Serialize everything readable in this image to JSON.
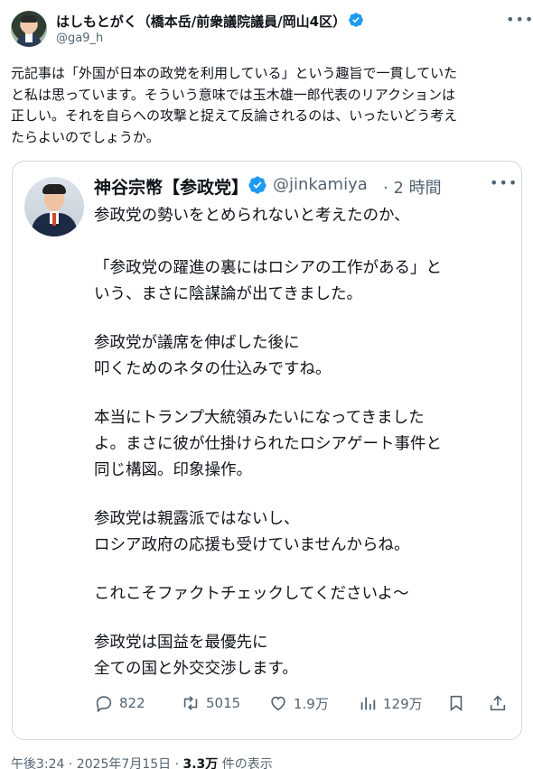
{
  "post": {
    "author_name": "はしもとがく（橋本岳/前衆議院議員/岡山4区）",
    "author_handle": "@ga9_h",
    "text_lines": [
      "元記事は「外国が日本の政党を利用している」という趣旨で一貫していた",
      "と私は思っています。そういう意味では玉木雄一郎代表のリアクションは",
      "正しい。それを自らへの攻撃と捉えて反論されるのは、いったいどう考え",
      "たらよいのでしょうか。"
    ]
  },
  "quoted": {
    "name": "神谷宗幣【参政党】",
    "handle": "@jinkamiya",
    "time": "· 2 時間",
    "lines": [
      "参政党の勢いをとめられないと考えたのか、",
      "「参政党の躍進の裏にはロシアの工作がある」と",
      "いう、まさに陰謀論が出てきました。",
      "参政党が議席を伸ばした後に",
      "叩くためのネタの仕込みですね。",
      "本当にトランプ大統領みたいになってきました",
      "よ。まさに彼が仕掛けられたロシアゲート事件と",
      "同じ構図。印象操作。",
      "参政党は親露派ではないし、",
      "ロシア政府の応援も受けていませんからね。",
      "これこそファクトチェックしてくださいよ～",
      "参政党は国益を最優先に",
      "全ての国と外交交渉します。"
    ],
    "stats": {
      "replies": "822",
      "reposts": "5015",
      "likes": "1.9万",
      "views": "129万"
    }
  },
  "footer": {
    "time": "午後3:24 · 2025年7月15日 · ",
    "views_count": "3.3万",
    "views_label": " 件の表示"
  },
  "colors": {
    "verified": "#1d9bf0",
    "muted": "#536471",
    "border": "#cfd9de"
  }
}
